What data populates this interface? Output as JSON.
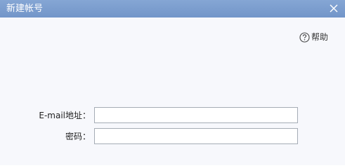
{
  "window": {
    "title": "新建帐号",
    "close_icon": "close-icon"
  },
  "help": {
    "icon": "help-circle-icon",
    "label": "帮助"
  },
  "form": {
    "email": {
      "label": "E-mail地址：",
      "value": "",
      "placeholder": ""
    },
    "password": {
      "label": "密码：",
      "value": "",
      "placeholder": ""
    }
  },
  "colors": {
    "titlebar": "#7b9dce",
    "background": "#f7f8fc",
    "input_border": "#a5acb5"
  }
}
